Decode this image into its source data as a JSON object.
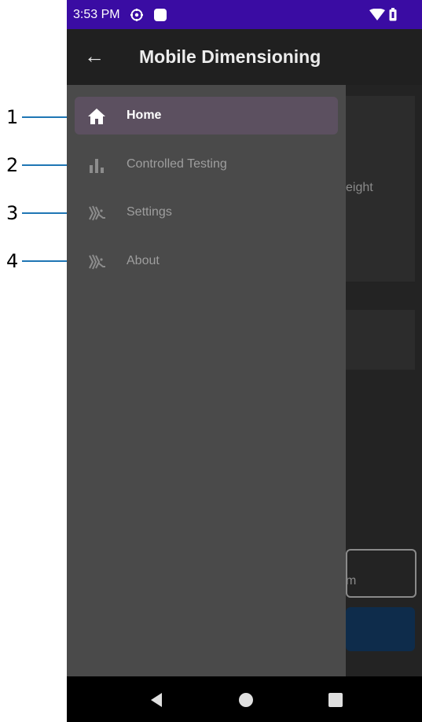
{
  "callouts": [
    "1",
    "2",
    "3",
    "4"
  ],
  "status_bar": {
    "time": "3:53 PM",
    "icons": [
      "gear-icon",
      "square-notification-icon",
      "wifi-icon",
      "battery-icon"
    ]
  },
  "app_bar": {
    "back_icon": "arrow-left-icon",
    "back_glyph": "←",
    "title": "Mobile Dimensioning"
  },
  "drawer": {
    "items": [
      {
        "label": "Home",
        "icon": "home-icon",
        "active": true
      },
      {
        "label": "Controlled Testing",
        "icon": "bar-chart-icon",
        "active": false
      },
      {
        "label": "Settings",
        "icon": "zebra-logo-icon",
        "active": false
      },
      {
        "label": "About",
        "icon": "zebra-logo-icon",
        "active": false
      }
    ]
  },
  "background": {
    "partial_text_1": "eight",
    "partial_text_2": "m"
  },
  "nav_bar": {
    "icons": [
      "back-triangle-icon",
      "home-circle-icon",
      "recents-square-icon"
    ]
  },
  "colors": {
    "status_bar": "#3a0ca3",
    "callout_line": "#1f76b4",
    "drawer": "#4a4a4a",
    "active_item": "#5c5060",
    "primary_button": "#0e2c4b"
  }
}
